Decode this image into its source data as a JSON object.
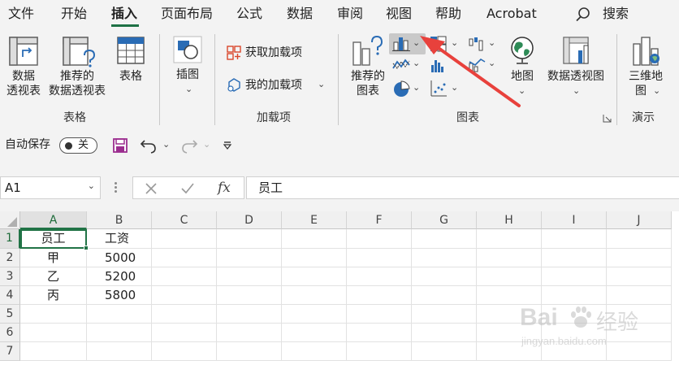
{
  "menu": {
    "tabs": [
      "文件",
      "开始",
      "插入",
      "页面布局",
      "公式",
      "数据",
      "审阅",
      "视图",
      "帮助",
      "Acrobat"
    ],
    "active_tab": "插入",
    "search_label": "搜索"
  },
  "ribbon": {
    "table_group": {
      "label": "表格",
      "pivot_table": [
        "数据",
        "透视表"
      ],
      "recommended_pivot": [
        "推荐的",
        "数据透视表"
      ],
      "table": "表格"
    },
    "illustrations": {
      "label": "插图"
    },
    "addins_group": {
      "label": "加载项",
      "get_addins": "获取加载项",
      "my_addins": "我的加载项"
    },
    "charts_group": {
      "label": "图表",
      "recommended_charts": [
        "推荐的",
        "图表"
      ],
      "maps": "地图",
      "pivot_chart": "数据透视图"
    },
    "tours_group": {
      "label": "演示",
      "map_3d": [
        "三维地",
        "图"
      ]
    }
  },
  "qat": {
    "autosave_label": "自动保存",
    "autosave_state": "关"
  },
  "formula_bar": {
    "name_box": "A1",
    "fx_label": "fx",
    "content": "员工"
  },
  "sheet": {
    "columns": [
      "A",
      "B",
      "C",
      "D",
      "E",
      "F",
      "G",
      "H",
      "I",
      "J"
    ],
    "rows": [
      "1",
      "2",
      "3",
      "4",
      "5",
      "6",
      "7"
    ],
    "cells": [
      [
        "员工",
        "工资"
      ],
      [
        "甲",
        "5000"
      ],
      [
        "乙",
        "5200"
      ],
      [
        "丙",
        "5800"
      ]
    ],
    "selected_cell": "A1"
  },
  "watermark": {
    "brand": "Bai",
    "brand_tail": "经验",
    "url": "jingyan.baidu.com"
  },
  "colors": {
    "accent": "#217346",
    "arrow": "#e8413c",
    "highlight": "#c9c9c9"
  }
}
